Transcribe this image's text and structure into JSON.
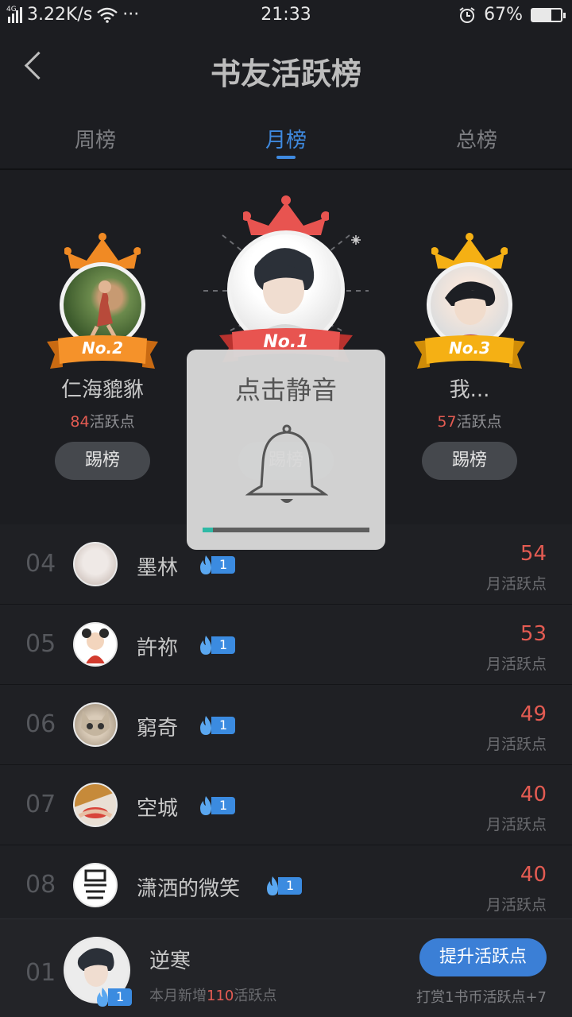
{
  "status_bar": {
    "network": "4G",
    "speed": "3.22K/s",
    "more": "···",
    "time": "21:33",
    "battery": "67%",
    "battery_level": 0.67
  },
  "header": {
    "title": "书友活跃榜"
  },
  "tabs": [
    {
      "label": "周榜",
      "active": false
    },
    {
      "label": "月榜",
      "active": true
    },
    {
      "label": "总榜",
      "active": false
    }
  ],
  "podium": {
    "second": {
      "badge": "No.2",
      "name": "仁海貔貅",
      "points": "84",
      "points_suffix": "活跃点",
      "kick": "踢榜"
    },
    "first": {
      "badge": "No.1",
      "name": "",
      "points": "",
      "points_suffix": "",
      "kick": "踢榜"
    },
    "third": {
      "badge": "No.3",
      "name": "我...",
      "points": "57",
      "points_suffix": "活跃点",
      "kick": "踢榜"
    }
  },
  "list": [
    {
      "rank": "04",
      "name": "墨林",
      "level": "1",
      "score": "54",
      "score_label": "月活跃点"
    },
    {
      "rank": "05",
      "name": "許祢",
      "level": "1",
      "score": "53",
      "score_label": "月活跃点"
    },
    {
      "rank": "06",
      "name": "窮奇",
      "level": "1",
      "score": "49",
      "score_label": "月活跃点"
    },
    {
      "rank": "07",
      "name": "空城",
      "level": "1",
      "score": "40",
      "score_label": "月活跃点"
    },
    {
      "rank": "08",
      "name": "潇洒的微笑",
      "level": "1",
      "score": "40",
      "score_label": "月活跃点"
    }
  ],
  "mine": {
    "rank": "01",
    "name": "逆寒",
    "level": "1",
    "sub_prefix": "本月新增",
    "sub_value": "110",
    "sub_suffix": "活跃点",
    "boost": "提升活跃点",
    "reward": "打赏1书币活跃点+7"
  },
  "toast": {
    "title": "点击静音",
    "volume_level": 0.06
  },
  "colors": {
    "accent": "#3f8ae0",
    "score_red": "#e35b52",
    "gold": "#f5a623",
    "orange": "#f08a24",
    "red": "#e85450"
  },
  "icons": [
    "back-arrow-icon",
    "wifi-icon",
    "alarm-icon",
    "battery-icon",
    "crown-icon",
    "flame-icon",
    "bell-icon"
  ]
}
